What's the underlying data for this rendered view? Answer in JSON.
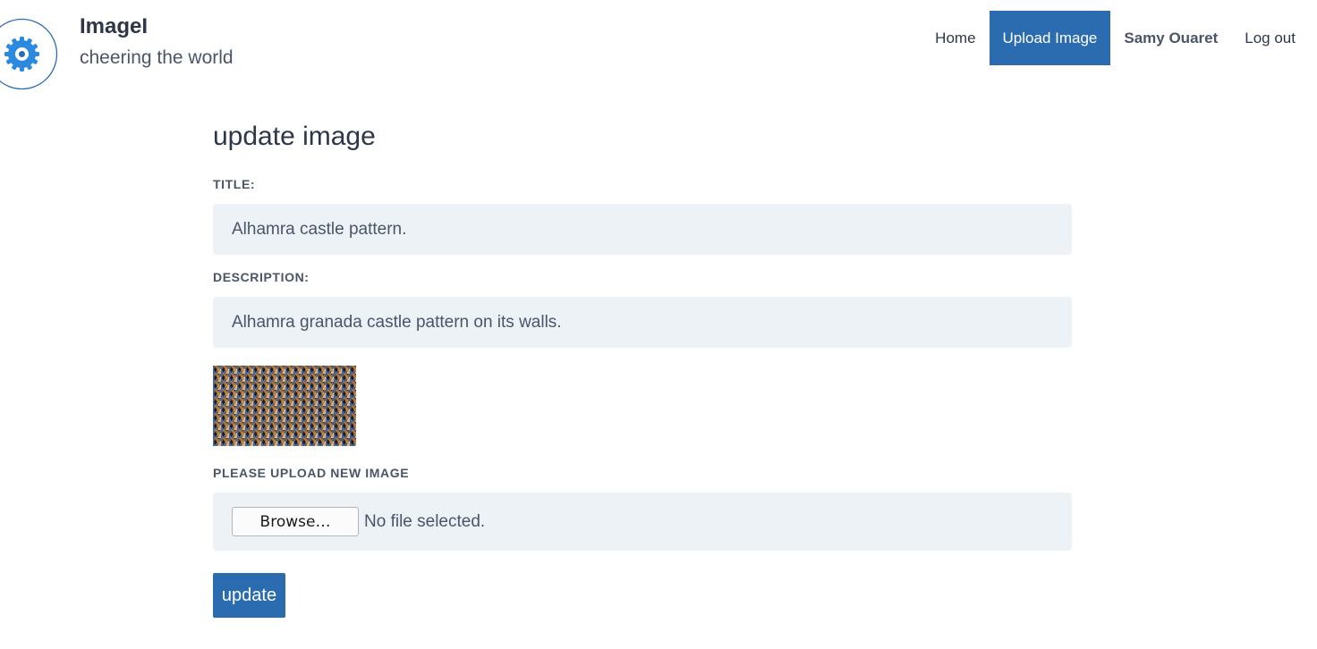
{
  "brand": {
    "logo_icon": "cog-logo-icon",
    "title": "ImageI",
    "tagline": "cheering the world"
  },
  "nav": {
    "home": "Home",
    "upload": "Upload Image",
    "user": "Samy Ouaret",
    "logout": "Log out"
  },
  "form": {
    "heading": "update image",
    "title_label": "TITLE:",
    "title_value": "Alhamra castle pattern.",
    "description_label": "DESCRIPTION:",
    "description_value": "Alhamra granada castle pattern on its walls.",
    "upload_label": "PLEASE UPLOAD NEW IMAGE",
    "browse_button": "Browse…",
    "file_status": "No file selected.",
    "submit_button": "update"
  },
  "colors": {
    "accent": "#2b6cb0",
    "field_bg": "#edf2f7",
    "logo_blue": "#2b8ae0"
  }
}
